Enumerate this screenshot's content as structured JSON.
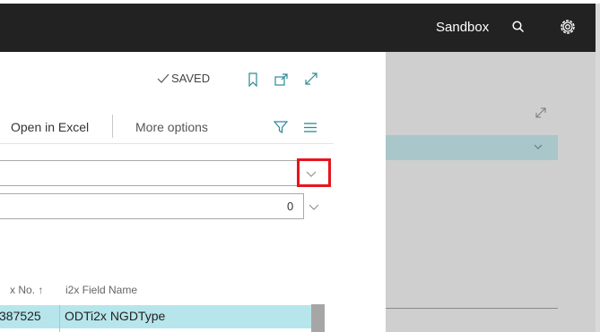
{
  "topbar": {
    "environment_label": "Sandbox",
    "search_icon": "search-icon",
    "settings_icon": "gear-icon"
  },
  "panel": {
    "status": "SAVED",
    "toolbar": {
      "open_in_excel": "Open in Excel",
      "more_options": "More options"
    },
    "number_field_value": "0",
    "columns": {
      "no_header": "x No. ↑",
      "field_name_header": "i2x Field Name"
    },
    "rows": [
      {
        "no": "387525",
        "field_name": "ODTi2x NGDType"
      }
    ]
  },
  "colors": {
    "topbar_bg": "#222222",
    "row_highlight": "#b6e6ec",
    "accent": "#2d8a96",
    "annotation_box": "#e8141c"
  }
}
